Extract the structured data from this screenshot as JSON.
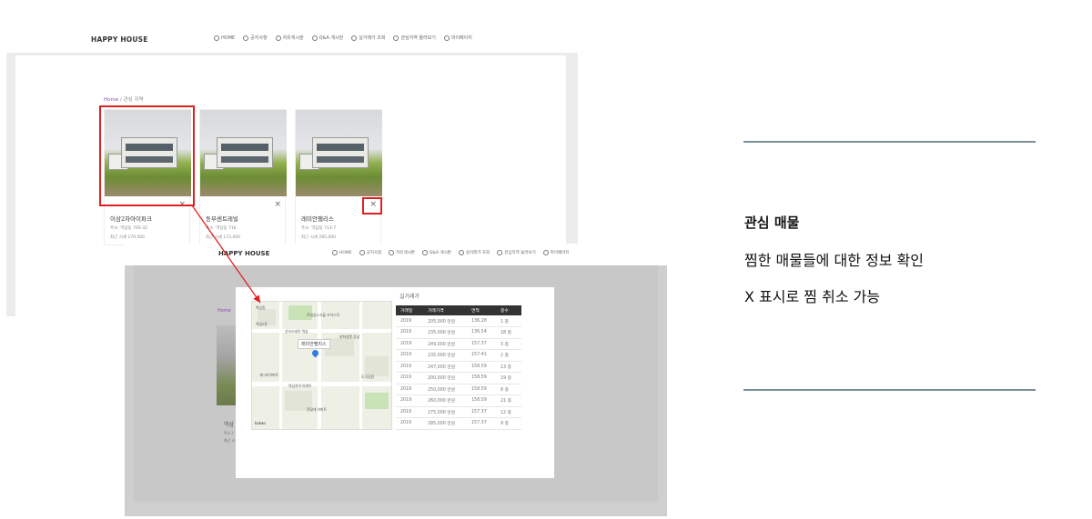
{
  "screen1": {
    "brand": "HAPPY HOUSE",
    "menu": [
      {
        "label": "HOME",
        "icon": "home-icon"
      },
      {
        "label": "공지사항",
        "icon": "info-icon"
      },
      {
        "label": "자유게시판",
        "icon": "chat-icon"
      },
      {
        "label": "Q&A 게시판",
        "icon": "question-icon"
      },
      {
        "label": "실거래가 조회",
        "icon": "dollar-icon"
      },
      {
        "label": "관심지역 둘러보기",
        "icon": "bookmark-icon"
      },
      {
        "label": "마이페이지",
        "icon": "user-icon"
      }
    ],
    "breadcrumb": {
      "home": "Home",
      "sep": " / ",
      "current": "관심 지역"
    },
    "properties": [
      {
        "name": "이삼2차아이파크",
        "addr": "주소: 역삼동 765-32",
        "price": "최근 시세 179,500"
      },
      {
        "name": "동부센트레빌",
        "addr": "주소: 역삼동 716",
        "price": "최근 시세 172,000"
      },
      {
        "name": "래미안팰리스",
        "addr": "주소: 역삼동 713-7",
        "price": "최근 시세 285,000"
      }
    ],
    "remove_symbol": "×"
  },
  "screen2": {
    "brand": "HAPPY HOUSE",
    "menu": [
      {
        "label": "HOME",
        "icon": "home-icon"
      },
      {
        "label": "공지사항",
        "icon": "info-icon"
      },
      {
        "label": "자유게시판",
        "icon": "chat-icon"
      },
      {
        "label": "Q&A 게시판",
        "icon": "question-icon"
      },
      {
        "label": "실거래가 조회",
        "icon": "dollar-icon"
      },
      {
        "label": "관심지역 둘러보기",
        "icon": "bookmark-icon"
      },
      {
        "label": "마이페이지",
        "icon": "user-icon"
      }
    ],
    "breadcrumb_home": "Home",
    "bg_name": "역삼",
    "bg_addr": "주소 /",
    "bg_price": "최근 시",
    "map": {
      "tooltip": "래미안팰리스",
      "labels": [
        "역삼동",
        "역삼2동",
        "르네상스서울 조이스틱",
        "신라스테이 역삼",
        "한화생명 강남",
        "도곡공원",
        "개나리아파트",
        "역삼자이 아파트",
        "진달래 아파트"
      ],
      "logo": "kakao"
    },
    "deals": {
      "title": "실거래가",
      "headers": [
        "거래일",
        "거래가격",
        "면적",
        "층수"
      ],
      "rows": [
        [
          "2019",
          "205,000 만원",
          "136.28",
          "1 층"
        ],
        [
          "2019",
          "235,000 만원",
          "136.54",
          "18 층"
        ],
        [
          "2019",
          "249,000 만원",
          "157.37",
          "3 층"
        ],
        [
          "2019",
          "235,000 만원",
          "157.41",
          "2 층"
        ],
        [
          "2019",
          "247,000 만원",
          "158.59",
          "13 층"
        ],
        [
          "2019",
          "200,000 만원",
          "158.59",
          "19 층"
        ],
        [
          "2019",
          "250,000 만원",
          "158.59",
          "8 층"
        ],
        [
          "2019",
          "260,000 만원",
          "158.59",
          "21 층"
        ],
        [
          "2019",
          "275,000 만원",
          "157.37",
          "12 층"
        ],
        [
          "2019",
          "285,000 만원",
          "157.37",
          "9 층"
        ]
      ]
    }
  },
  "caption": {
    "title": "관심 매물",
    "line1": "찜한 매물들에 대한 정보 확인",
    "line2": "X 표시로 찜 취소 가능"
  },
  "colors": {
    "highlight": "#e02020",
    "rule": "#7a8f99",
    "accent": "#8a4fbf"
  }
}
